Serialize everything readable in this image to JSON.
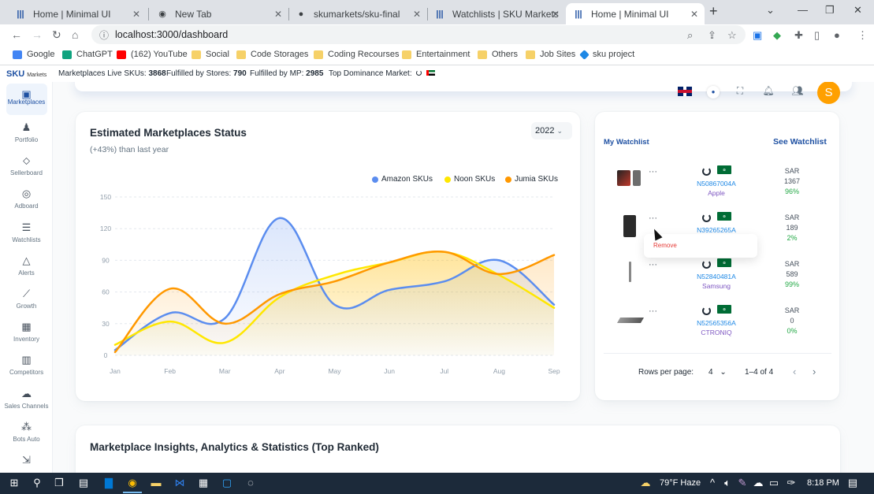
{
  "browser": {
    "tabs": [
      {
        "title": "Home | Minimal UI",
        "icon": "bars-icon"
      },
      {
        "title": "New Tab",
        "icon": "chrome-icon"
      },
      {
        "title": "skumarkets/sku-final",
        "icon": "github-icon"
      },
      {
        "title": "Watchlists | SKU Markets",
        "icon": "bars-icon"
      },
      {
        "title": "Home | Minimal UI",
        "icon": "bars-icon"
      }
    ],
    "url": "localhost:3000/dashboard",
    "bookmarks": [
      {
        "label": "Google",
        "color": "#4285f4"
      },
      {
        "label": "ChatGPT",
        "color": "#10a37f"
      },
      {
        "label": "(162) YouTube",
        "color": "#ff0000"
      },
      {
        "label": "Social",
        "color": "#f6d168"
      },
      {
        "label": "Code Storages",
        "color": "#f6d168"
      },
      {
        "label": "Coding Recourses",
        "color": "#f6d168"
      },
      {
        "label": "Entertainment",
        "color": "#f6d168"
      },
      {
        "label": "Others",
        "color": "#f6d168"
      },
      {
        "label": "Job Sites",
        "color": "#f6d168"
      },
      {
        "label": "sku project",
        "color": "#1e88e5"
      }
    ]
  },
  "app": {
    "logo": "SKU",
    "logo_small": "Markets",
    "stats": [
      {
        "label": "Marketplaces Live SKUs:",
        "value": "3868"
      },
      {
        "label": "Fulfilled by Stores:",
        "value": "790"
      },
      {
        "label": "Fulfilled by MP:",
        "value": "2985"
      },
      {
        "label": "Top Dominance Market:",
        "value": ""
      }
    ],
    "avatar_letter": "S",
    "accent": "#1e50a2"
  },
  "sidebar": {
    "items": [
      {
        "label": "Marketplaces",
        "icon": "bag-icon"
      },
      {
        "label": "Portfolio",
        "icon": "person-icon"
      },
      {
        "label": "Sellerboard",
        "icon": "tag-icon"
      },
      {
        "label": "Adboard",
        "icon": "target-icon"
      },
      {
        "label": "Watchlists",
        "icon": "list-star-icon"
      },
      {
        "label": "Alerts",
        "icon": "bell-icon"
      },
      {
        "label": "Growth",
        "icon": "chart-line-icon"
      },
      {
        "label": "Inventory",
        "icon": "inventory-icon"
      },
      {
        "label": "Competitors",
        "icon": "building-icon"
      },
      {
        "label": "Sales Channels",
        "icon": "cloud-icon"
      },
      {
        "label": "Bots Auto",
        "icon": "nodes-icon"
      },
      {
        "label": "",
        "icon": "import-icon"
      }
    ]
  },
  "chart_card": {
    "title": "Estimated Marketplaces Status",
    "subtitle": "(+43%) than last year",
    "year": "2022"
  },
  "chart_data": {
    "type": "area",
    "categories": [
      "Jan",
      "Feb",
      "Mar",
      "Apr",
      "May",
      "Jun",
      "Jul",
      "Aug",
      "Sep"
    ],
    "ylim": [
      0,
      150
    ],
    "yticks": [
      0,
      30,
      60,
      90,
      120,
      150
    ],
    "grid": true,
    "legend": "top-right",
    "series": [
      {
        "name": "Amazon SKUs",
        "color": "#5b8def",
        "values": [
          5,
          40,
          35,
          130,
          48,
          62,
          70,
          90,
          48
        ]
      },
      {
        "name": "Noon SKUs",
        "color": "#ffe700",
        "values": [
          10,
          32,
          12,
          55,
          76,
          88,
          98,
          76,
          45
        ]
      },
      {
        "name": "Jumia SKUs",
        "color": "#ff9800",
        "values": [
          3,
          63,
          30,
          58,
          70,
          88,
          98,
          77,
          95
        ]
      }
    ]
  },
  "watchlist": {
    "title": "My Watchlist",
    "link": "See Watchlist",
    "remove_label": "Remove",
    "items": [
      {
        "sku": "N50867004A",
        "brand": "Apple",
        "currency": "SAR",
        "price": "1367",
        "change": "96%",
        "img": "phone-icon"
      },
      {
        "sku": "N39265265A",
        "brand": "",
        "currency": "SAR",
        "price": "189",
        "change": "2%",
        "img": "speaker-icon"
      },
      {
        "sku": "N52840481A",
        "brand": "Samsung",
        "currency": "SAR",
        "price": "589",
        "change": "99%",
        "img": "stick-icon"
      },
      {
        "sku": "N52565356A",
        "brand": "CTRONIQ",
        "currency": "SAR",
        "price": "0",
        "change": "0%",
        "img": "laptop-icon"
      }
    ],
    "rows_per_page_label": "Rows per page:",
    "rows_per_page": "4",
    "range": "1–4 of 4"
  },
  "insights": {
    "title": "Marketplace Insights, Analytics & Statistics (Top Ranked)"
  },
  "taskbar": {
    "weather": "79°F  Haze",
    "time": "8:18 PM"
  }
}
